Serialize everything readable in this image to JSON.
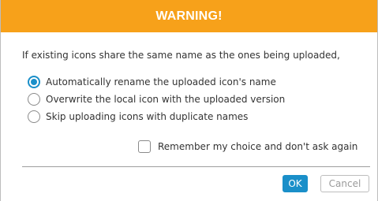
{
  "dialog": {
    "title": "WARNING!",
    "message": "If existing icons share the same name as the ones being uploaded,",
    "options": [
      {
        "label": "Automatically rename the uploaded icon's name",
        "selected": true
      },
      {
        "label": "Overwrite the local icon with the uploaded version",
        "selected": false
      },
      {
        "label": "Skip uploading icons with duplicate names",
        "selected": false
      }
    ],
    "remember_label": "Remember my choice and don't ask again",
    "remember_checked": false,
    "ok_label": "OK",
    "cancel_label": "Cancel"
  },
  "colors": {
    "title_bar": "#f7a11a",
    "accent": "#1a8fc9"
  }
}
